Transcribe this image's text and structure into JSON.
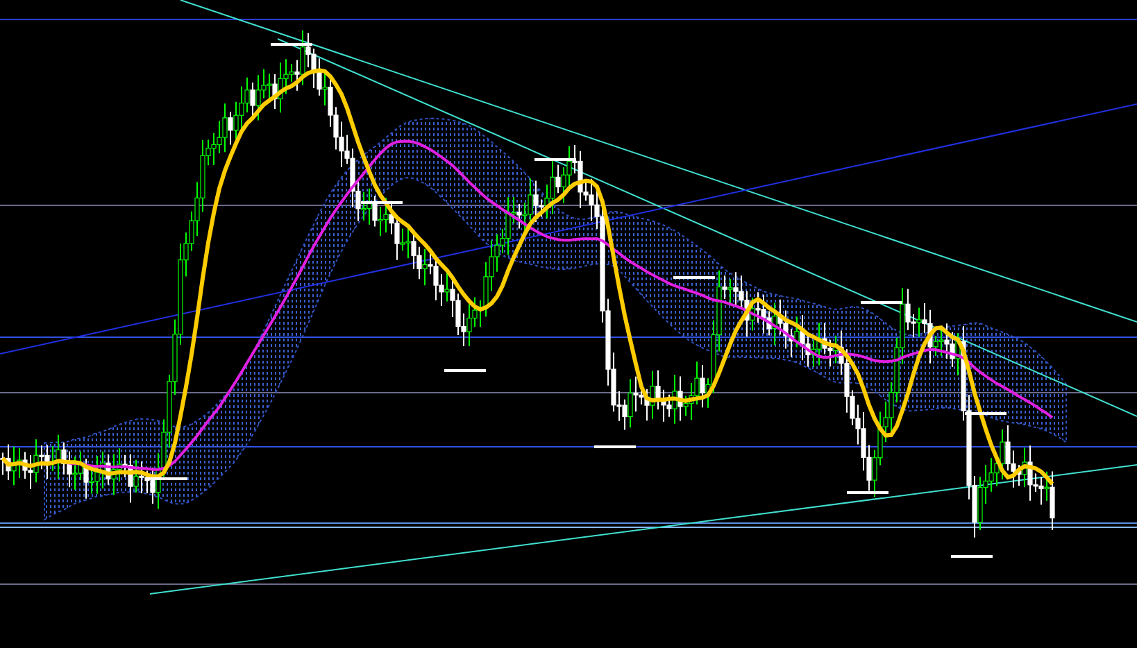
{
  "series": [
    {
      "kind": "candles"
    },
    {
      "kind": "cloud"
    },
    {
      "kind": "average",
      "color": "#e020e0"
    },
    {
      "kind": "average",
      "color": "#ffcc00"
    },
    {
      "kind": "fractals"
    }
  ]
}
